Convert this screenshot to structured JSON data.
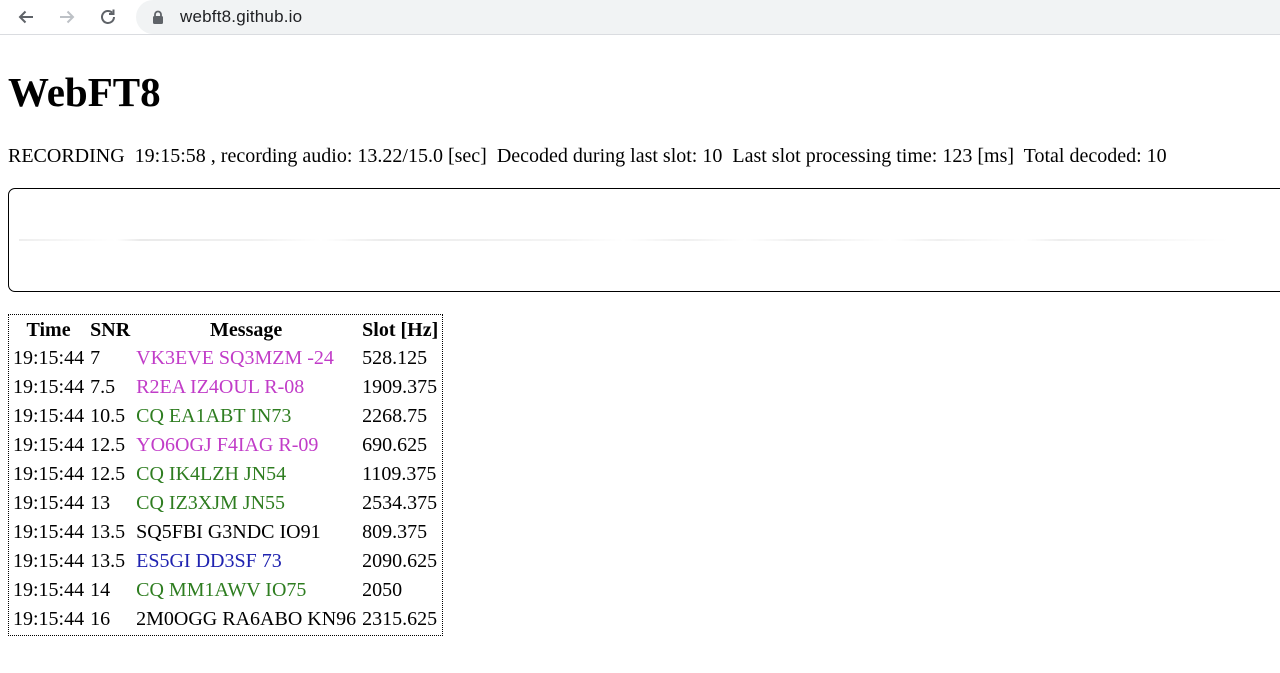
{
  "browser": {
    "url": "webft8.github.io",
    "icons": {
      "back": "arrow-left-icon",
      "forward": "arrow-right-icon",
      "reload": "reload-icon",
      "lock": "lock-icon"
    }
  },
  "page": {
    "title": "WebFT8",
    "status": {
      "state": "RECORDING",
      "time": "19:15:58",
      "recording_label": ", recording audio:",
      "recording_value": "13.22/15.0 [sec]",
      "decoded_label": "Decoded during last slot:",
      "decoded_value": "10",
      "processing_label": "Last slot processing time:",
      "processing_value": "123 [ms]",
      "total_label": "Total decoded:",
      "total_value": "10"
    }
  },
  "colors": {
    "magenta": "#c13cc8",
    "green": "#2e7d20",
    "blue": "#1f23b0",
    "black": "#000000"
  },
  "table": {
    "headers": [
      "Time",
      "SNR",
      "Message",
      "Slot [Hz]"
    ],
    "rows": [
      {
        "time": "19:15:44",
        "snr": "7",
        "message": "VK3EVE SQ3MZM -24",
        "slot": "528.125",
        "color": "#c13cc8"
      },
      {
        "time": "19:15:44",
        "snr": "7.5",
        "message": "R2EA IZ4OUL R-08",
        "slot": "1909.375",
        "color": "#c13cc8"
      },
      {
        "time": "19:15:44",
        "snr": "10.5",
        "message": "CQ EA1ABT IN73",
        "slot": "2268.75",
        "color": "#2e7d20"
      },
      {
        "time": "19:15:44",
        "snr": "12.5",
        "message": "YO6OGJ F4IAG R-09",
        "slot": "690.625",
        "color": "#c13cc8"
      },
      {
        "time": "19:15:44",
        "snr": "12.5",
        "message": "CQ IK4LZH JN54",
        "slot": "1109.375",
        "color": "#2e7d20"
      },
      {
        "time": "19:15:44",
        "snr": "13",
        "message": "CQ IZ3XJM JN55",
        "slot": "2534.375",
        "color": "#2e7d20"
      },
      {
        "time": "19:15:44",
        "snr": "13.5",
        "message": "SQ5FBI G3NDC IO91",
        "slot": "809.375",
        "color": "#000000"
      },
      {
        "time": "19:15:44",
        "snr": "13.5",
        "message": "ES5GI DD3SF 73",
        "slot": "2090.625",
        "color": "#1f23b0"
      },
      {
        "time": "19:15:44",
        "snr": "14",
        "message": "CQ MM1AWV IO75",
        "slot": "2050",
        "color": "#2e7d20"
      },
      {
        "time": "19:15:44",
        "snr": "16",
        "message": "2M0OGG RA6ABO KN96",
        "slot": "2315.625",
        "color": "#000000"
      }
    ]
  }
}
